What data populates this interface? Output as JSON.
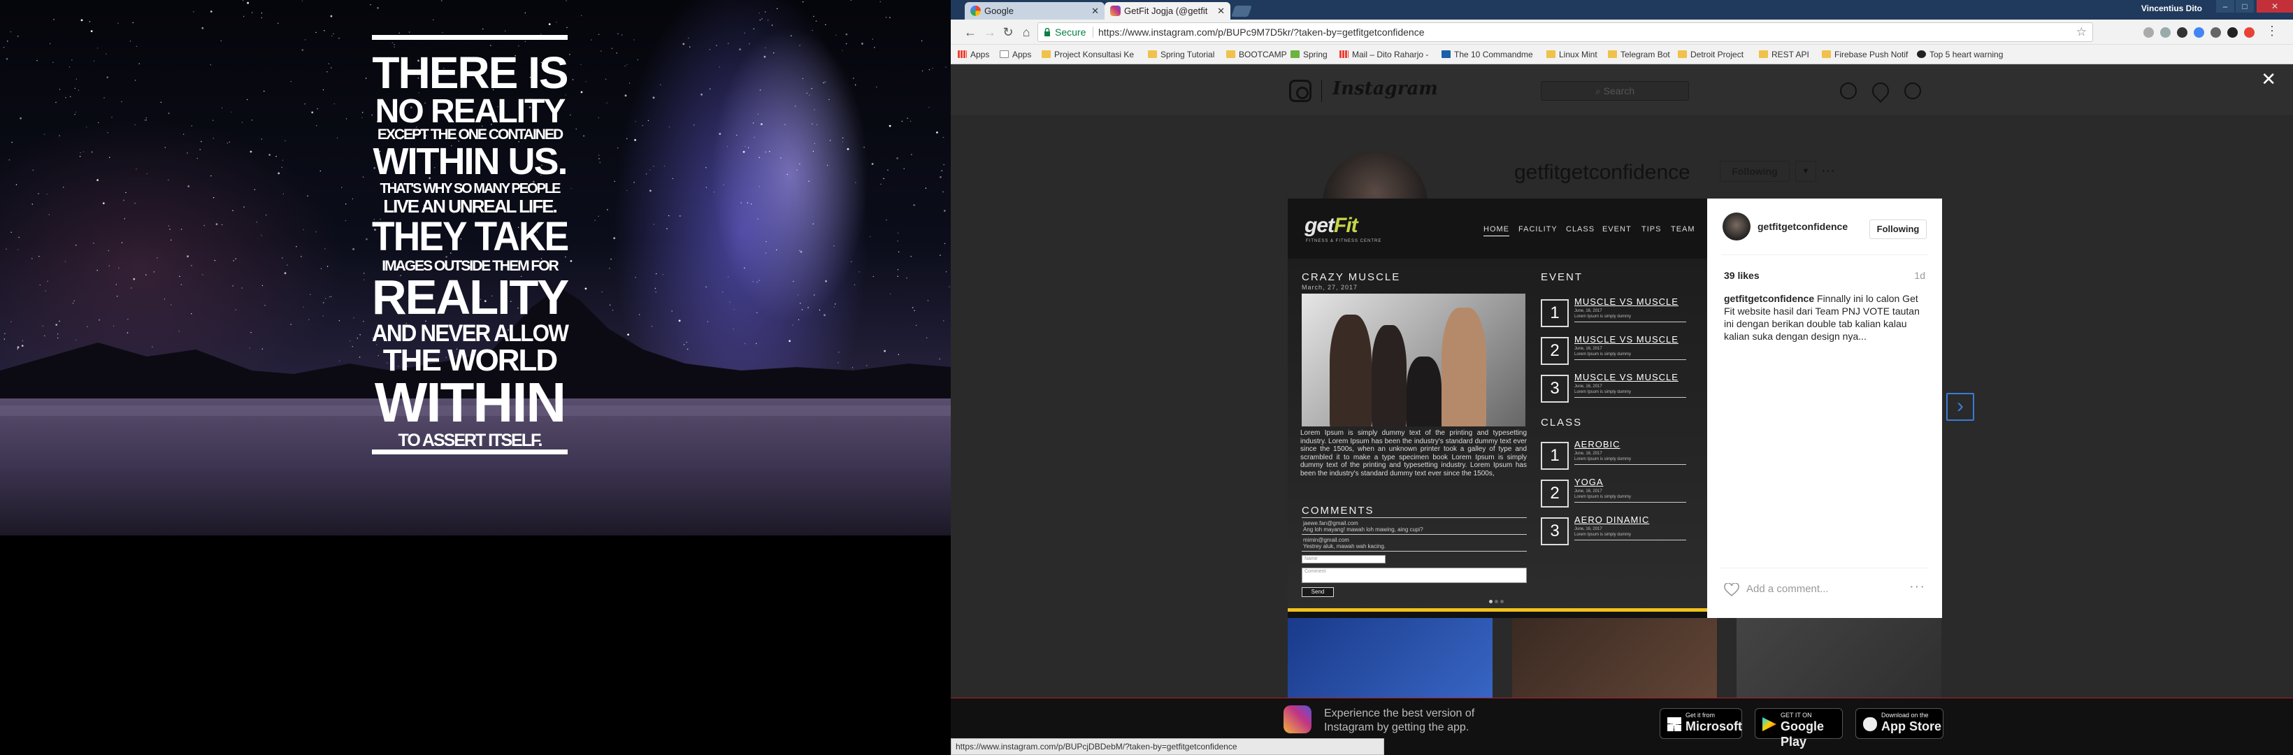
{
  "wallpaper": {
    "quote_lines": [
      "THERE IS",
      "NO REALITY",
      "EXCEPT THE ONE CONTAINED",
      "WITHIN US.",
      "THAT'S WHY SO MANY PEOPLE",
      "LIVE AN UNREAL LIFE.",
      "THEY TAKE",
      "IMAGES OUTSIDE THEM FOR",
      "REALITY",
      "AND NEVER ALLOW",
      "THE WORLD",
      "WITHIN",
      "TO ASSERT ITSELF."
    ]
  },
  "browser": {
    "tabs": [
      {
        "title": "Google",
        "favicon": "google-icon"
      },
      {
        "title": "GetFit Jogja (@getfitget…",
        "favicon": "instagram-icon"
      }
    ],
    "profile_name": "Vincentius Dito",
    "window_buttons": [
      "–",
      "□",
      "✕"
    ],
    "secure_label": "Secure",
    "url": "https://www.instagram.com/p/BUPc9M7D5kr/?taken-by=getfitgetconfidence",
    "bookmarks": [
      "Apps",
      "Apps",
      "Project Konsultasi Ke",
      "Spring Tutorial",
      "BOOTCAMP",
      "Spring",
      "Mail – Dito Raharjo -",
      "The 10 Commandme",
      "Linux Mint",
      "Telegram Bot",
      "Detroit Project",
      "REST API",
      "Firebase Push Notif",
      "Top 5 heart warning"
    ],
    "status_url": "https://www.instagram.com/p/BUPcjDBDebM/?taken-by=getfitgetconfidence"
  },
  "instagram": {
    "wordmark": "Instagram",
    "search_placeholder": "Search",
    "profile": {
      "username": "getfitgetconfidence",
      "following_label": "Following",
      "more": "···"
    },
    "close_label": "✕",
    "next_label": "›",
    "post": {
      "username": "getfitgetconfidence",
      "following_label": "Following",
      "likes": "39 likes",
      "age": "1d",
      "caption_user": "getfitgetconfidence",
      "caption_text": " Finnally ini lo calon Get Fit website hasil dari Team PNJ VOTE tautan ini dengan berikan double tab kalian kalau kalian suka dengan design nya...",
      "comment_placeholder": "Add a comment...",
      "more": "···"
    },
    "banner": {
      "line1": "Experience the best version of",
      "line2": "Instagram by getting the app.",
      "stores": [
        {
          "small": "Get it from",
          "big": "Microsoft"
        },
        {
          "small": "GET IT ON",
          "big": "Google Play"
        },
        {
          "small": "Download on the",
          "big": "App Store"
        }
      ]
    }
  },
  "getfit_mockup": {
    "logo_get": "get",
    "logo_fit": "Fit",
    "logo_sub": "FITNESS & FITNESS CENTRE",
    "menu": [
      "HOME",
      "FACILITY",
      "CLASS",
      "EVENT",
      "TIPS",
      "TEAM"
    ],
    "article_title": "CRAZY MUSCLE",
    "article_date": "March, 27, 2017",
    "article_text": "Lorem Ipsum is simply dummy text of the printing and typesetting industry. Lorem Ipsum has been the industry's standard dummy text ever since the 1500s, when an unknown printer took a galley of type and scrambled it to make a type specimen book Lorem Ipsum is simply dummy text of the printing and typesetting industry. Lorem Ipsum has been the industry's standard dummy text ever since the 1500s,",
    "comments_title": "COMMENTS",
    "comments": [
      {
        "author": "jaewe.fan@gmail.com",
        "text": "Ang loh mayang! mawah loh mawing, aing cupi?"
      },
      {
        "author": "mimin@gmail.com",
        "text": "Yestrey aluk, mawah wah kacing."
      }
    ],
    "name_placeholder": "Name",
    "comment_placeholder": "Comment",
    "send_label": "Send",
    "event_title": "EVENT",
    "events": [
      {
        "num": "1",
        "title": "MUSCLE VS MUSCLE",
        "date": "June, 16, 2017",
        "desc": "Lorem Ipsum is simply dummy"
      },
      {
        "num": "2",
        "title": "MUSCLE VS MUSCLE",
        "date": "June, 16, 2017",
        "desc": "Lorem Ipsum is simply dummy"
      },
      {
        "num": "3",
        "title": "MUSCLE VS MUSCLE",
        "date": "June, 16, 2017",
        "desc": "Lorem Ipsum is simply dummy"
      }
    ],
    "class_title": "CLASS",
    "classes": [
      {
        "num": "1",
        "title": "AEROBIC",
        "date": "June, 16, 2017",
        "desc": "Lorem Ipsum is simply dummy"
      },
      {
        "num": "2",
        "title": "YOGA",
        "date": "June, 16, 2017",
        "desc": "Lorem Ipsum is simply dummy"
      },
      {
        "num": "3",
        "title": "AERO DINAMIC",
        "date": "June, 16, 2017",
        "desc": "Lorem Ipsum is simply dummy"
      }
    ]
  },
  "colors": {
    "tabstrip": "#1f3a5c",
    "secure_green": "#0b8043",
    "getfit_accent": "#c7d44a",
    "getfit_footer": "#f2c21b",
    "next_arrow": "#3a7bd5"
  }
}
